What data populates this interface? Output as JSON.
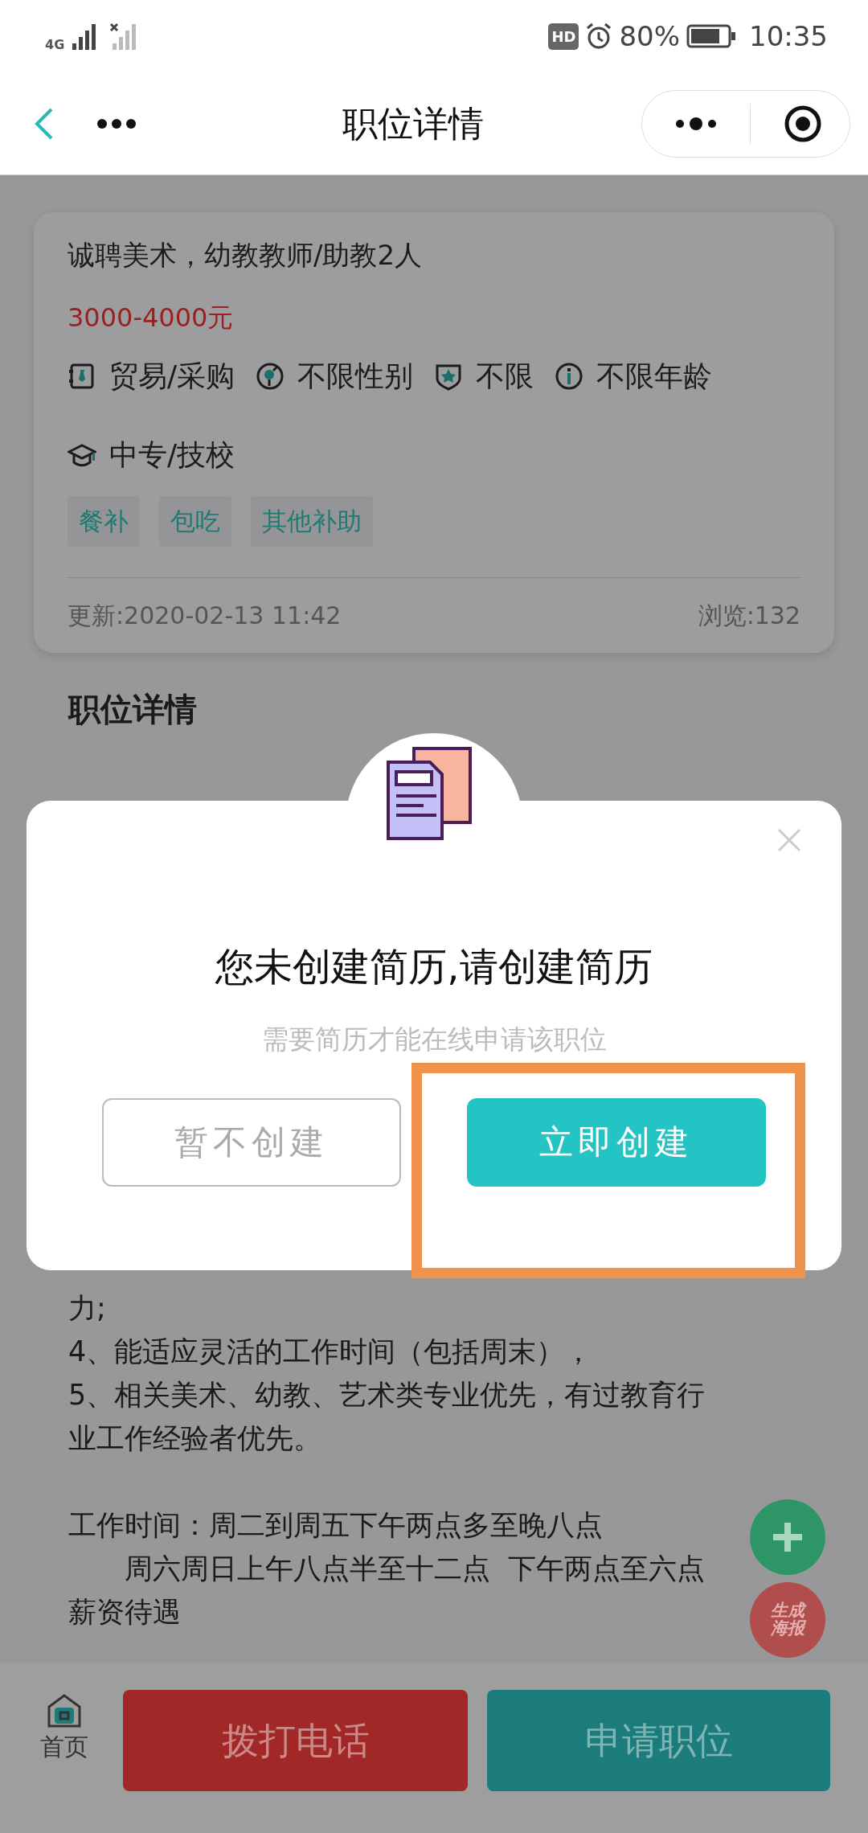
{
  "status_bar": {
    "network": "4G",
    "hd": "HD",
    "battery": "80%",
    "time": "10:35"
  },
  "nav": {
    "title": "职位详情"
  },
  "job": {
    "title": "诚聘美术，幼教教师/助教2人",
    "salary": "3000-4000元",
    "attributes": [
      {
        "kind": "industry",
        "text": "贸易/采购"
      },
      {
        "kind": "gender",
        "text": "不限性别"
      },
      {
        "kind": "experience",
        "text": "不限"
      },
      {
        "kind": "age",
        "text": "不限年龄"
      },
      {
        "kind": "education",
        "text": "中专/技校"
      }
    ],
    "tags": [
      "餐补",
      "包吃",
      "其他补助"
    ],
    "updated": "更新:2020-02-13 11:42",
    "views": "浏览:132"
  },
  "details": {
    "heading": "职位详情",
    "lines": [
      {
        "kind": "plain",
        "text": "力;"
      },
      {
        "kind": "plain",
        "text": "4、能适应灵活的工作时间（包括周末），"
      },
      {
        "kind": "plain",
        "text": "5、相关美术、幼教、艺术类专业优先，有过教育行业工作经验者优先。"
      },
      {
        "kind": "spaced",
        "text": "工作时间：周二到周五下午两点多至晚八点"
      },
      {
        "kind": "indented",
        "text": "周六周日上午八点半至十二点  下午两点至六点"
      },
      {
        "kind": "plain",
        "text": "薪资待遇"
      }
    ]
  },
  "dialog": {
    "title": "您未创建简历,请创建简历",
    "subtitle": "需要简历才能在线申请该职位",
    "buttons": [
      {
        "label": "暂不创建",
        "kind": "outline",
        "highlighted": false
      },
      {
        "label": "立即创建",
        "kind": "primary",
        "highlighted": true
      }
    ]
  },
  "fabs": [
    {
      "kind": "add"
    },
    {
      "kind": "poster",
      "label": "生成海报"
    }
  ],
  "bottom_bar": {
    "home_label": "首页",
    "buttons": [
      {
        "label": "拨打电话",
        "kind": "call"
      },
      {
        "label": "申请职位",
        "kind": "apply"
      }
    ]
  }
}
